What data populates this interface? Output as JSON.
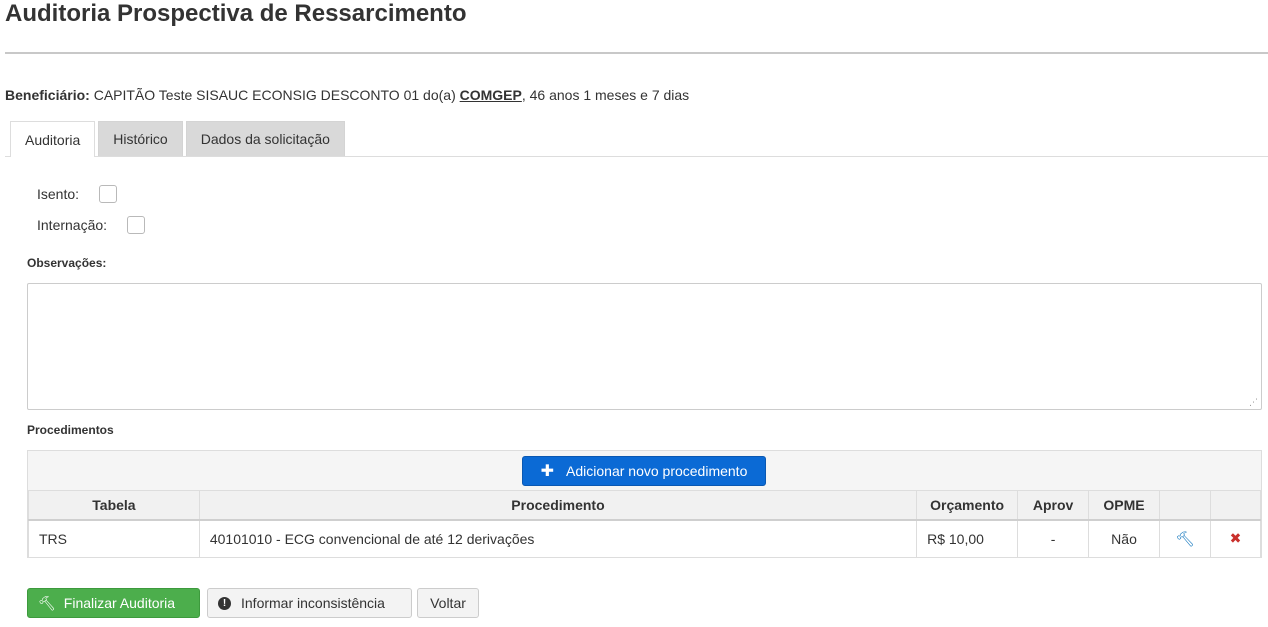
{
  "page": {
    "title": "Auditoria Prospectiva de Ressarcimento"
  },
  "beneficiary": {
    "label": "Beneficiário:",
    "name": " CAPITÃO Teste SISAUC ECONSIG DESCONTO 01 do(a) ",
    "org": "COMGEP",
    "age": ", 46 anos 1 meses e 7 dias"
  },
  "tabs": [
    {
      "label": "Auditoria",
      "active": true
    },
    {
      "label": "Histórico",
      "active": false
    },
    {
      "label": "Dados da solicitação",
      "active": false
    }
  ],
  "form": {
    "isento_label": "Isento:",
    "isento_checked": false,
    "internacao_label": "Internação:",
    "internacao_checked": false,
    "observacoes_label": "Observações:",
    "observacoes_value": ""
  },
  "procedimentos": {
    "section_label": "Procedimentos",
    "add_button_label": "Adicionar novo procedimento",
    "columns": [
      "Tabela",
      "Procedimento",
      "Orçamento",
      "Aprov",
      "OPME",
      "",
      ""
    ],
    "rows": [
      {
        "tabela": "TRS",
        "procedimento": "40101010 - ECG convencional de até 12 derivações",
        "orcamento": "R$ 10,00",
        "aprov": "-",
        "opme": "Não",
        "action1_icon": "gavel-icon",
        "action2_icon": "remove-icon"
      }
    ]
  },
  "actions": {
    "finish_label": "Finalizar Auditoria",
    "inform_label": "Informar inconsistência",
    "back_label": "Voltar"
  },
  "colors": {
    "primary": "#0b6ad5",
    "success": "#4cae4c",
    "danger": "#c9302c",
    "info": "#1a7bc0"
  }
}
